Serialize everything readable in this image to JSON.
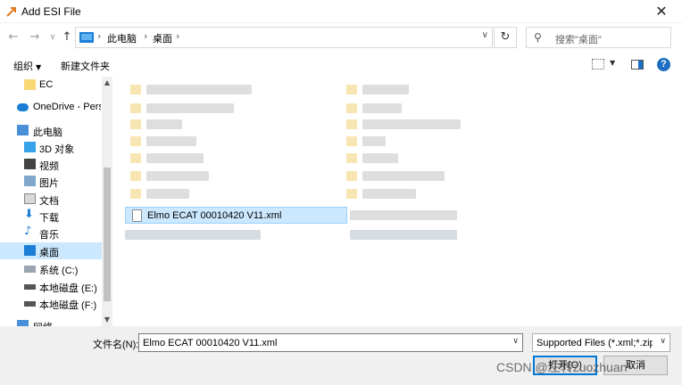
{
  "window": {
    "title": "Add ESI File"
  },
  "nav": {
    "back": "←",
    "forward": "→",
    "recent": "∨",
    "up": "↑",
    "breadcrumbs": [
      "此电脑",
      "桌面"
    ],
    "refresh": "↻",
    "search_placeholder": "搜索\"桌面\""
  },
  "toolbar": {
    "organize": "组织",
    "new_folder": "新建文件夹",
    "help": "?"
  },
  "sidebar": {
    "items": [
      {
        "label": "EC",
        "icon": "folder-icon"
      },
      {
        "label": "OneDrive - Perso",
        "icon": "cloud-icon"
      },
      {
        "label": "此电脑",
        "icon": "computer-icon"
      },
      {
        "label": "3D 对象",
        "icon": "3d-objects-icon"
      },
      {
        "label": "视频",
        "icon": "video-icon"
      },
      {
        "label": "图片",
        "icon": "pictures-icon"
      },
      {
        "label": "文档",
        "icon": "documents-icon"
      },
      {
        "label": "下载",
        "icon": "download-icon"
      },
      {
        "label": "音乐",
        "icon": "music-icon"
      },
      {
        "label": "桌面",
        "icon": "desktop-icon",
        "selected": true
      },
      {
        "label": "系统 (C:)",
        "icon": "drive-icon"
      },
      {
        "label": "本地磁盘 (E:)",
        "icon": "drive-icon"
      },
      {
        "label": "本地磁盘 (F:)",
        "icon": "drive-icon"
      },
      {
        "label": "网络",
        "icon": "network-icon"
      }
    ]
  },
  "files": {
    "selected": {
      "name": "Elmo ECAT 00010420 V11.xml",
      "icon": "xml-file-icon"
    }
  },
  "footer": {
    "filename_label": "文件名(N):",
    "filename_value": "Elmo ECAT 00010420 V11.xml",
    "filetype_value": "Supported Files (*.xml;*.zip;*",
    "open_button": "打开(O)",
    "cancel_button": "取消",
    "watermark": "CSDN @左转zuozhuan"
  },
  "colors": {
    "selection": "#cce8ff",
    "accent": "#0078d7",
    "folder": "#f8e6b2"
  }
}
